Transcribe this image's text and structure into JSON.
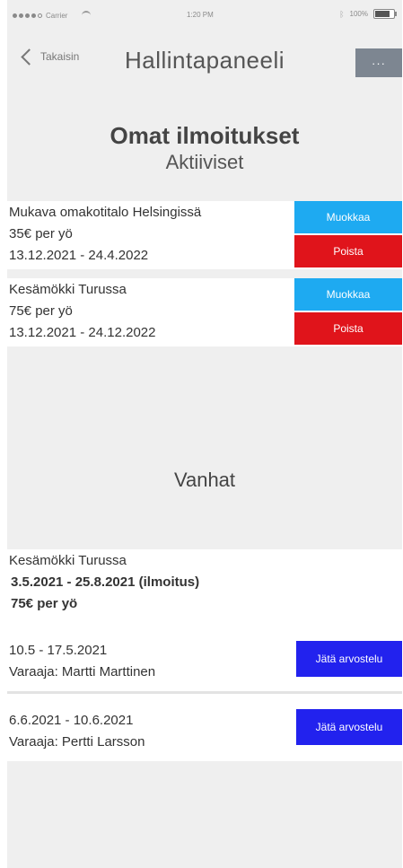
{
  "statusbar": {
    "carrier": "Carrier",
    "time": "1:20 PM",
    "battery": "100%"
  },
  "nav": {
    "back_label": "Takaisin",
    "title": "Hallintapaneeli",
    "more_label": "···"
  },
  "heading": {
    "title": "Omat ilmoitukset",
    "subtitle": "Aktiiviset"
  },
  "active": [
    {
      "name": "Mukava omakotitalo Helsingissä",
      "price": "35€ per yö",
      "dates": "13.12.2021 - 24.4.2022",
      "edit_label": "Muokkaa",
      "delete_label": "Poista"
    },
    {
      "name": "Kesämökki Turussa",
      "price": "75€ per yö",
      "dates": "13.12.2021 - 24.12.2022",
      "edit_label": "Muokkaa",
      "delete_label": "Poista"
    }
  ],
  "old_heading": "Vanhat",
  "old": {
    "name": "Kesämökki Turussa",
    "period": "3.5.2021 - 25.8.2021 (ilmoitus)",
    "price": "75€ per yö",
    "bookings": [
      {
        "dates": "10.5 - 17.5.2021",
        "booker": "Varaaja: Martti Marttinen",
        "review_label": "Jätä arvostelu"
      },
      {
        "dates": "6.6.2021 - 10.6.2021",
        "booker": "Varaaja: Pertti Larsson",
        "review_label": "Jätä arvostelu"
      }
    ]
  },
  "colors": {
    "edit": "#1eaaf1",
    "delete": "#e0141b",
    "review": "#2222ee",
    "more": "#7d8691"
  }
}
